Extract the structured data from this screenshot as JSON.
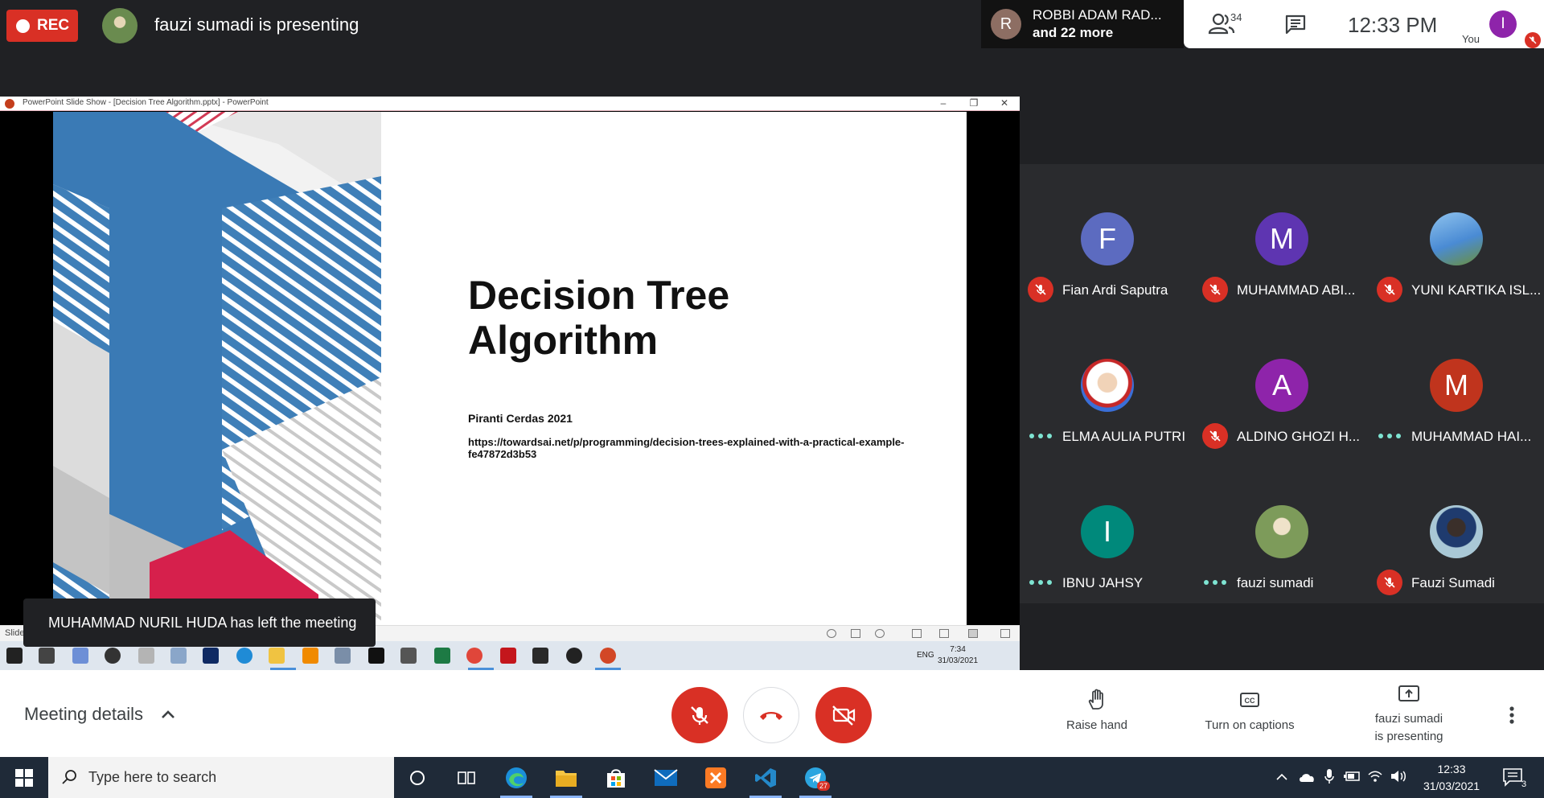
{
  "topbar": {
    "rec_label": "REC",
    "presenting_text": "fauzi sumadi is presenting",
    "others_avatar_letter": "R",
    "others_line1": "ROBBI ADAM RAD...",
    "others_line2": "and 22 more",
    "people_count": "34",
    "time": "12:33  PM",
    "you_label": "You",
    "you_avatar_letter": "I"
  },
  "shared_screen": {
    "window_title": "PowerPoint Slide Show - [Decision Tree Algorithm.pptx] - PowerPoint",
    "slide_title": "Decision Tree Algorithm",
    "slide_subtitle": "Piranti Cerdas 2021",
    "slide_url": "https://towardsai.net/p/programming/decision-trees-explained-with-a-practical-example-fe47872d3b53",
    "status_text": "Slide",
    "inner_tray_lang": "ENG",
    "inner_clock_time": "7:34",
    "inner_clock_date": "31/03/2021"
  },
  "toast": {
    "message": "MUHAMMAD NURIL HUDA has left the meeting"
  },
  "participants": [
    {
      "name": "Fian Ardi Saputra",
      "letter": "F",
      "color": "#5c6bc0",
      "status": "muted"
    },
    {
      "name": "MUHAMMAD ABI...",
      "letter": "M",
      "color": "#5e35b1",
      "status": "muted"
    },
    {
      "name": "YUNI KARTIKA ISL...",
      "letter": "",
      "color": "#4a8bd4",
      "status": "muted"
    },
    {
      "name": "ELMA AULIA PUTRI",
      "letter": "",
      "color": "#3a6fd8",
      "status": "speaking"
    },
    {
      "name": "ALDINO GHOZI H...",
      "letter": "A",
      "color": "#8e24aa",
      "status": "muted"
    },
    {
      "name": "MUHAMMAD HAI...",
      "letter": "M",
      "color": "#c62828",
      "status": "speaking"
    },
    {
      "name": "IBNU JAHSY",
      "letter": "I",
      "color": "#00897b",
      "status": "speaking"
    },
    {
      "name": "fauzi sumadi",
      "letter": "",
      "color": "#6a8b4f",
      "status": "speaking"
    },
    {
      "name": "Fauzi Sumadi",
      "letter": "",
      "color": "#6e8fa6",
      "status": "muted"
    }
  ],
  "bottombar": {
    "meeting_details": "Meeting details",
    "raise_hand": "Raise hand",
    "captions": "Turn on captions",
    "presenting_line1": "fauzi sumadi",
    "presenting_line2": "is presenting"
  },
  "taskbar": {
    "search_placeholder": "Type here to search",
    "time": "12:33",
    "date": "31/03/2021",
    "notification_count": "3",
    "telegram_badge": "27"
  }
}
